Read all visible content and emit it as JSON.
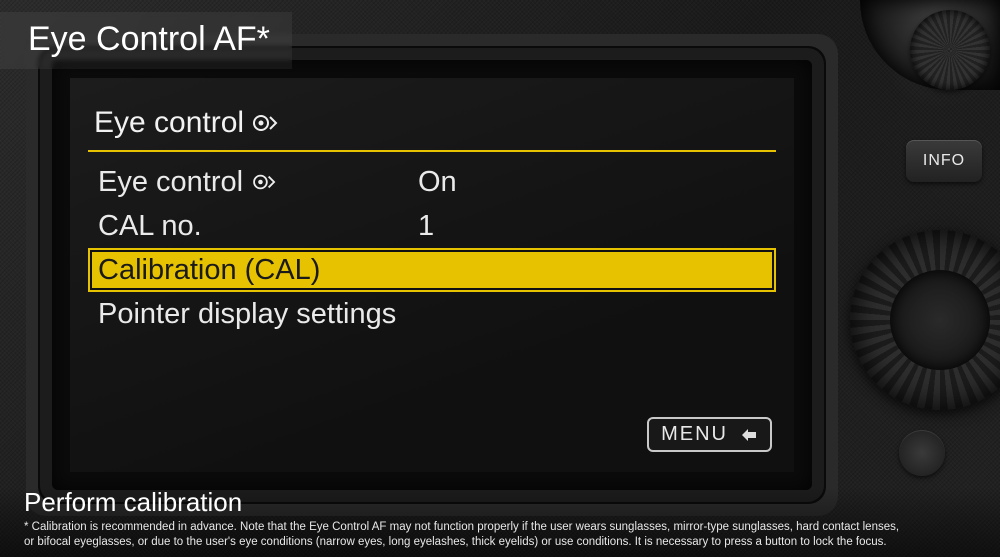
{
  "overlay": {
    "top_banner": "Eye Control AF*",
    "bottom_title": "Perform calibration",
    "footnote_line1": "* Calibration is recommended in advance. Note that the Eye Control AF may not function properly if the user wears sunglasses, mirror-type sunglasses, hard contact lenses,",
    "footnote_line2": "or bifocal eyeglasses, or due to the user's eye conditions (narrow eyes, long eyelashes, thick eyelids) or use conditions. It is necessary to press a button to lock the focus."
  },
  "camera_buttons": {
    "info": "INFO"
  },
  "menu": {
    "title": "Eye control",
    "title_icon": "eye-control-icon",
    "items": [
      {
        "label": "Eye control",
        "icon": "eye-control-icon",
        "value": "On",
        "selected": false
      },
      {
        "label": "CAL no.",
        "value": "1",
        "selected": false
      },
      {
        "label": "Calibration (CAL)",
        "value": "",
        "selected": true
      },
      {
        "label": "Pointer display settings",
        "value": "",
        "selected": false
      }
    ],
    "footer_button": "MENU",
    "footer_icon": "back-icon"
  }
}
